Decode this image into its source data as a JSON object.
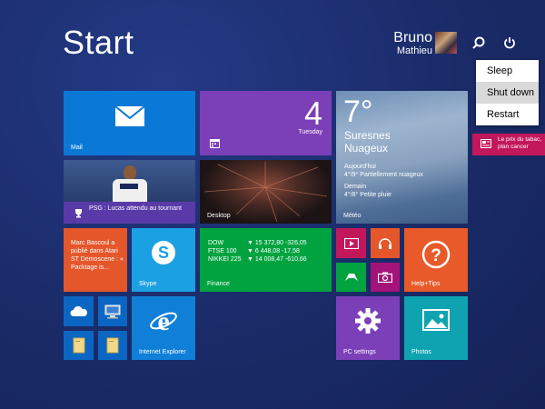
{
  "start": {
    "title": "Start"
  },
  "user": {
    "first": "Bruno",
    "last": "Mathieu"
  },
  "power_menu": {
    "items": [
      "Sleep",
      "Shut down",
      "Restart"
    ]
  },
  "tiles": {
    "mail": {
      "label": "Mail"
    },
    "calendar": {
      "day": "4",
      "weekday": "Tuesday"
    },
    "weather": {
      "temp": "7°",
      "city": "Suresnes",
      "condition": "Nuageux",
      "today_label": "Aujourd'hui",
      "today": "4°/9° Partiellement nuageux",
      "tomorrow_label": "Demain",
      "tomorrow": "4°/8° Petite pluie",
      "label": "Météo"
    },
    "news": {
      "text": "Le prix du tabac, plan cancer"
    },
    "sports": {
      "text": "PSG : Lucas attendu au tournant"
    },
    "desktop": {
      "label": "Desktop"
    },
    "people": {
      "text": "Marc Bascoul a publié dans Atari ST Demoscene : « Packtage is..."
    },
    "skype": {
      "label": "Skype"
    },
    "finance": {
      "label": "Finance",
      "rows": [
        {
          "name": "DOW",
          "value": "▼ 15 372,80 -326,05"
        },
        {
          "name": "FTSE 100",
          "value": "▼ 6 448,08 -17,58"
        },
        {
          "name": "NIKKEI 225",
          "value": "▼ 14 008,47 -610,66"
        }
      ]
    },
    "help": {
      "label": "Help+Tips"
    },
    "ie": {
      "label": "Internet Explorer"
    },
    "pcsettings": {
      "label": "PC settings"
    },
    "photos": {
      "label": "Photos"
    }
  },
  "colors": {
    "mail": "#0a78d7",
    "calendar": "#7b3fb8",
    "finance": "#00a33f",
    "people": "#e5562b",
    "skype": "#1ba0e2",
    "help": "#e85a2a",
    "ie": "#0f7fd8",
    "pcsettings": "#7b3fb8",
    "photos": "#0fa3b1",
    "news": "#c2185b"
  }
}
